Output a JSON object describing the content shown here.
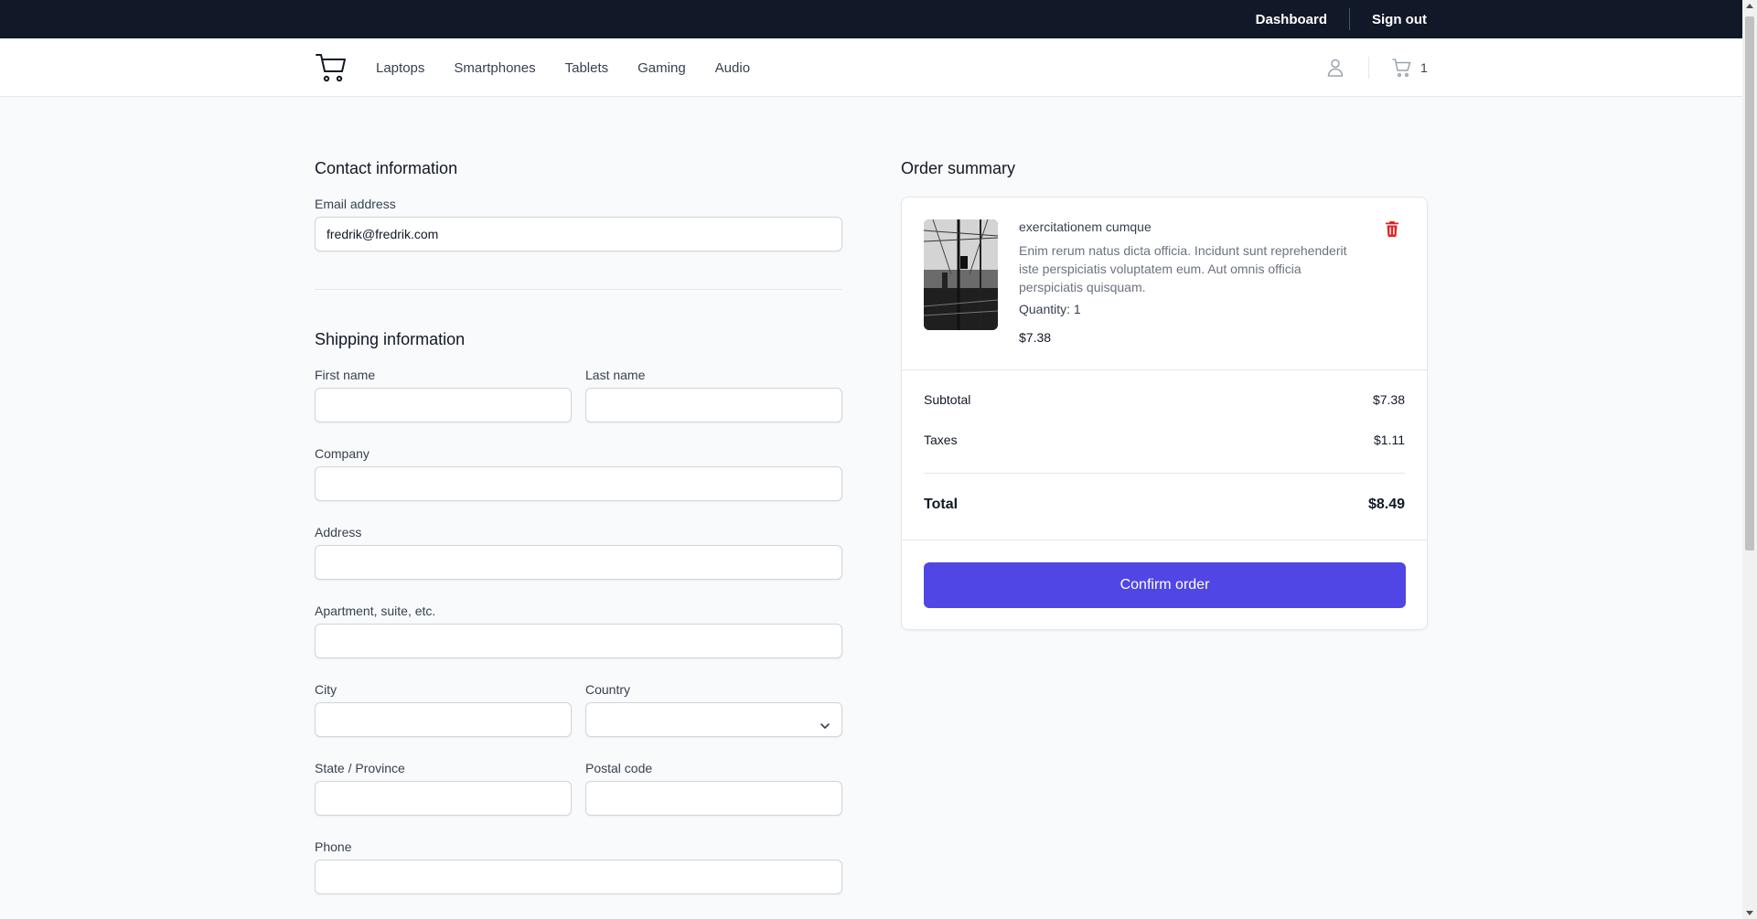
{
  "topbar": {
    "dashboard_label": "Dashboard",
    "signout_label": "Sign out"
  },
  "nav": {
    "logo_icon": "shopping-cart-icon",
    "links": [
      "Laptops",
      "Smartphones",
      "Tablets",
      "Gaming",
      "Audio"
    ],
    "cart_count": "1"
  },
  "contact": {
    "heading": "Contact information",
    "email_label": "Email address",
    "email_value": "fredrik@fredrik.com"
  },
  "shipping": {
    "heading": "Shipping information",
    "first_name_label": "First name",
    "last_name_label": "Last name",
    "company_label": "Company",
    "address_label": "Address",
    "apartment_label": "Apartment, suite, etc.",
    "city_label": "City",
    "country_label": "Country",
    "state_label": "State / Province",
    "postal_label": "Postal code",
    "phone_label": "Phone"
  },
  "summary": {
    "heading": "Order summary",
    "item": {
      "title": "exercitationem cumque",
      "description": "Enim rerum natus dicta officia. Incidunt sunt reprehenderit iste perspiciatis voluptatem eum. Aut omnis officia perspiciatis quisquam.",
      "quantity": "Quantity: 1",
      "price": "$7.38"
    },
    "subtotal_label": "Subtotal",
    "subtotal_value": "$7.38",
    "taxes_label": "Taxes",
    "taxes_value": "$1.11",
    "total_label": "Total",
    "total_value": "$8.49",
    "confirm_label": "Confirm order"
  },
  "colors": {
    "accent": "#4f46e5",
    "topbar": "#111827",
    "delete": "#dc2626"
  }
}
